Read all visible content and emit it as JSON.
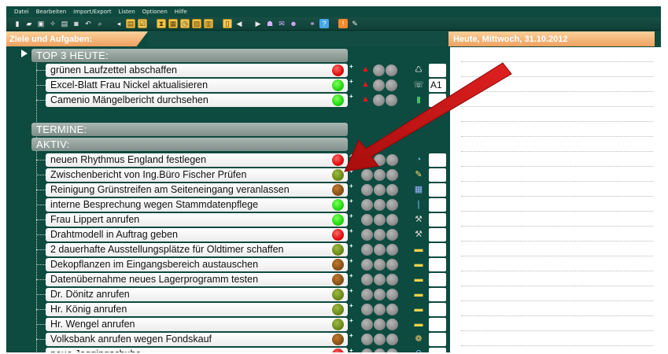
{
  "menu": [
    "Datei",
    "Bearbeiten",
    "Import/Export",
    "Listen",
    "Optionen",
    "Hilfe"
  ],
  "toolbar": {
    "icons": [
      {
        "name": "new-icon",
        "glyph": "▮",
        "style": ""
      },
      {
        "name": "open-icon",
        "glyph": "▰",
        "style": ""
      },
      {
        "name": "save-icon",
        "glyph": "▣",
        "style": ""
      },
      {
        "name": "settings-icon",
        "glyph": "✧",
        "style": ""
      },
      {
        "name": "print-icon",
        "glyph": "▤",
        "style": ""
      },
      {
        "name": "preview-icon",
        "glyph": "◙",
        "style": ""
      },
      {
        "name": "undo-icon",
        "glyph": "↶",
        "style": ""
      },
      {
        "name": "search-icon",
        "glyph": "⌕",
        "style": ""
      },
      {
        "name": "back-icon",
        "glyph": "◂",
        "style": ""
      },
      {
        "name": "note-icon",
        "glyph": "▤",
        "style": "y"
      },
      {
        "name": "check-list-icon",
        "glyph": "☑",
        "style": "y"
      },
      {
        "name": "hourglass-icon",
        "glyph": "⧗",
        "style": "y"
      },
      {
        "name": "calendar-icon",
        "glyph": "▦",
        "style": "y"
      },
      {
        "name": "clock-icon",
        "glyph": "◷",
        "style": "y"
      },
      {
        "name": "report-icon",
        "glyph": "▧",
        "style": "y"
      },
      {
        "name": "team-icon",
        "glyph": "▥",
        "style": "y"
      },
      {
        "name": "day-icon",
        "glyph": "▯",
        "style": "y"
      },
      {
        "name": "prev-icon",
        "glyph": "◀",
        "style": ""
      },
      {
        "name": "next-icon",
        "glyph": "▶",
        "style": ""
      },
      {
        "name": "contacts-icon",
        "glyph": "☗",
        "style": "p"
      },
      {
        "name": "mail-icon",
        "glyph": "✉",
        "style": "p"
      },
      {
        "name": "people-icon",
        "glyph": "☻",
        "style": "p"
      },
      {
        "name": "link-icon",
        "glyph": "⚭",
        "style": "p"
      },
      {
        "name": "help-icon",
        "glyph": "?",
        "style": "b"
      },
      {
        "name": "info-icon",
        "glyph": "!",
        "style": "o"
      },
      {
        "name": "pen-icon",
        "glyph": "✎",
        "style": ""
      }
    ]
  },
  "header": {
    "goals_title": "Ziele und Aufgaben:",
    "date": "Heute, Mittwoch, 31.10.2012"
  },
  "sections": {
    "top3": "TOP 3 HEUTE:",
    "termine": "TERMINE:",
    "aktiv": "AKTIV:"
  },
  "tasks": [
    {
      "label": "grünen Laufzettel abschaffen",
      "status": "red",
      "marker": "hat",
      "cat": "trash-icon",
      "catglyph": "♺",
      "box": ""
    },
    {
      "label": "Excel-Blatt Frau Nickel aktualisieren",
      "status": "green",
      "marker": "hat",
      "cat": "phone-icon",
      "catglyph": "☏",
      "box": "A1"
    },
    {
      "label": "Camenio Mängelbericht durchsehen",
      "status": "green",
      "marker": "hat",
      "cat": "flag-icon",
      "catglyph": "▮",
      "box": ""
    },
    {
      "label": "neuen Rhythmus England festlegen",
      "status": "red",
      "marker": "",
      "cat": "clock-icon",
      "catglyph": "◔",
      "box": ""
    },
    {
      "label": "Zwischenbericht von Ing.Büro Fischer Prüfen",
      "status": "olive",
      "marker": "",
      "cat": "pencil-icon",
      "catglyph": "✎",
      "box": ""
    },
    {
      "label": "Reinigung Grünstreifen am Seiteneingang veranlassen",
      "status": "brown",
      "marker": "",
      "cat": "calculator-icon",
      "catglyph": "▦",
      "box": ""
    },
    {
      "label": "interne Besprechung wegen Stammdatenpflege",
      "status": "green",
      "marker": "",
      "cat": "pin-icon",
      "catglyph": "❘",
      "box": ""
    },
    {
      "label": "Frau Lippert anrufen",
      "status": "green",
      "marker": "",
      "cat": "wrench-icon",
      "catglyph": "⚒",
      "box": ""
    },
    {
      "label": "Drahtmodell in Auftrag geben",
      "status": "red",
      "marker": "",
      "cat": "wrench-icon",
      "catglyph": "⚒",
      "box": ""
    },
    {
      "label": "2 dauerhafte Ausstellungsplätze für Oldtimer schaffen",
      "status": "olive",
      "marker": "",
      "cat": "folder-icon",
      "catglyph": "▬",
      "box": ""
    },
    {
      "label": "Dekopflanzen im Eingangsbereich austauschen",
      "status": "brown",
      "marker": "",
      "cat": "folder-icon",
      "catglyph": "▬",
      "box": ""
    },
    {
      "label": "Datenübernahme neues Lagerprogramm testen",
      "status": "brown",
      "marker": "",
      "cat": "folder-icon",
      "catglyph": "▬",
      "box": ""
    },
    {
      "label": "Dr. Dönitz anrufen",
      "status": "olive",
      "marker": "",
      "cat": "folder-icon",
      "catglyph": "▬",
      "box": ""
    },
    {
      "label": "Hr. König anrufen",
      "status": "olive",
      "marker": "",
      "cat": "folder-icon",
      "catglyph": "▬",
      "box": ""
    },
    {
      "label": "Hr. Wengel anrufen",
      "status": "olive",
      "marker": "",
      "cat": "folder-icon",
      "catglyph": "▬",
      "box": ""
    },
    {
      "label": "Volksbank anrufen wegen Fondskauf",
      "status": "brown",
      "marker": "",
      "cat": "coins-icon",
      "catglyph": "❁",
      "box": ""
    },
    {
      "label": "neue Joggingschuhe",
      "status": "red",
      "marker": "",
      "cat": "pin-icon",
      "catglyph": "⚲",
      "box": ""
    }
  ],
  "colors": {
    "background": "#0d4a3f",
    "header_orange": "#eea160",
    "arrow_red": "#d11a1a"
  }
}
